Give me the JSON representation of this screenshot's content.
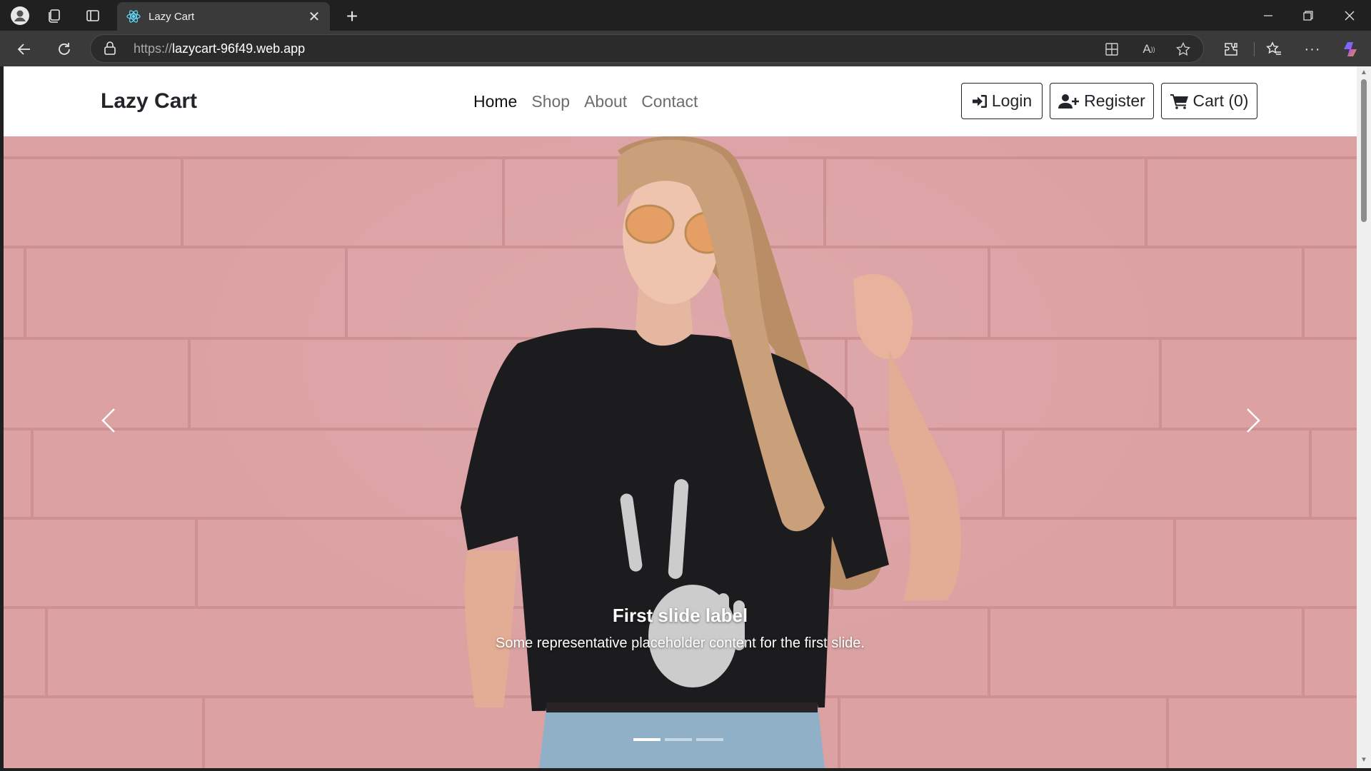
{
  "browser": {
    "tab_title": "Lazy Cart",
    "url_protocol": "https://",
    "url_host": "lazycart-96f49.web.app"
  },
  "site": {
    "brand": "Lazy Cart",
    "menu": [
      {
        "label": "Home",
        "active": true
      },
      {
        "label": "Shop",
        "active": false
      },
      {
        "label": "About",
        "active": false
      },
      {
        "label": "Contact",
        "active": false
      }
    ],
    "buttons": {
      "login": "Login",
      "register": "Register",
      "cart": "Cart (0)"
    }
  },
  "carousel": {
    "caption_title": "First slide label",
    "caption_text": "Some representative placeholder content for the first slide.",
    "slide_count": 3,
    "active_slide": 1
  },
  "colors": {
    "chrome_bg": "#202020",
    "toolbar_bg": "#3a3a3a",
    "hero_wall": "#dba1a3",
    "text_dark": "#212529"
  }
}
